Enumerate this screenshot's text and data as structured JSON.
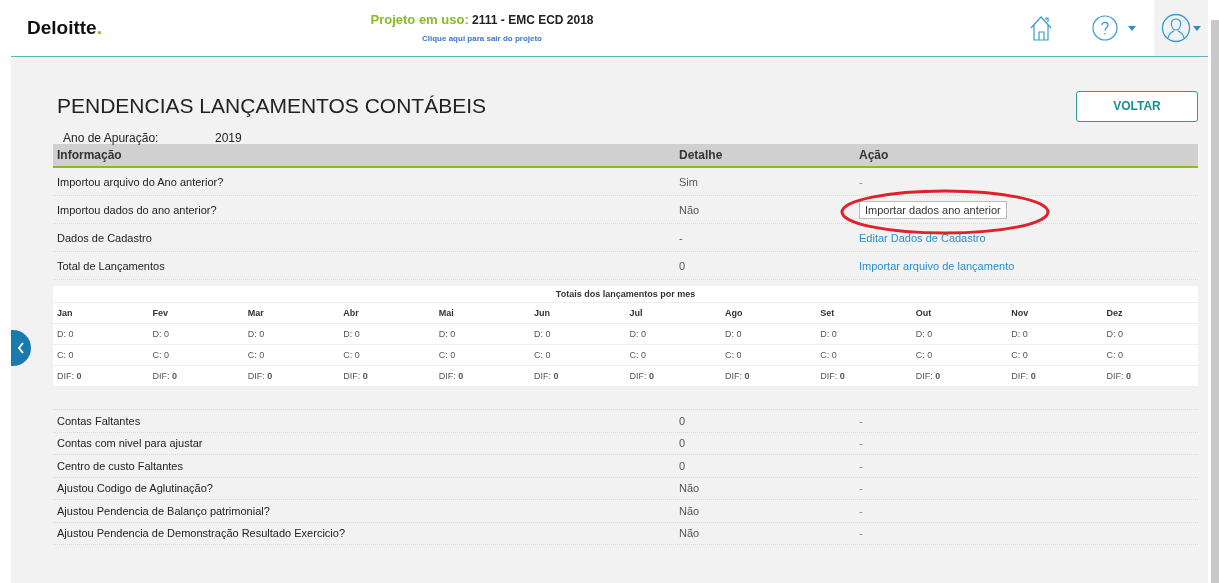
{
  "header": {
    "logo": "Deloitte",
    "logo_dot": ".",
    "project_label": "Projeto em uso:",
    "project_name": "2111 - EMC ECD 2018",
    "exit_link": "Clique aqui para sair do projeto"
  },
  "page": {
    "title": "PENDENCIAS LANÇAMENTOS CONTÁBEIS",
    "back_button": "VOLTAR",
    "year_label": "Ano de Apuração:",
    "year_value": "2019"
  },
  "table": {
    "columns": [
      "Informação",
      "Detalhe",
      "Ação"
    ],
    "rows": [
      {
        "info": "Importou arquivo do Ano anterior?",
        "detail": "Sim",
        "action": {
          "kind": "text",
          "text": "-"
        }
      },
      {
        "info": "Importou dados do ano anterior?",
        "detail": "Não",
        "action": {
          "kind": "button",
          "text": "Importar dados ano anterior",
          "circled": true
        }
      },
      {
        "info": "Dados de Cadastro",
        "detail": "-",
        "action": {
          "kind": "link",
          "text": "Editar Dados de Cadastro"
        }
      },
      {
        "info": "Total de Lançamentos",
        "detail": "0",
        "action": {
          "kind": "link",
          "text": "Importar arquivo de lançamento"
        }
      }
    ]
  },
  "monthly": {
    "title": "Totais dos lançamentos por mes",
    "months": [
      {
        "label": "Jan",
        "debit": "D: 0",
        "credit": "C: 0",
        "difference": "DIF: **0**"
      },
      {
        "label": "Fev",
        "debit": "D: 0",
        "credit": "C: 0",
        "difference": "DIF: **0**"
      },
      {
        "label": "Mar",
        "debit": "D: 0",
        "credit": "C: 0",
        "difference": "DIF: **0**"
      },
      {
        "label": "Abr",
        "debit": "D: 0",
        "credit": "C: 0",
        "difference": "DIF: **0**"
      },
      {
        "label": "Mai",
        "debit": "D: 0",
        "credit": "C: 0",
        "difference": "DIF: **0**"
      },
      {
        "label": "Jun",
        "debit": "D: 0",
        "credit": "C: 0",
        "difference": "DIF: **0**"
      },
      {
        "label": "Jul",
        "debit": "D: 0",
        "credit": "C: 0",
        "difference": "DIF: **0**"
      },
      {
        "label": "Ago",
        "debit": "D: 0",
        "credit": "C: 0",
        "difference": "DIF: **0**"
      },
      {
        "label": "Set",
        "debit": "D: 0",
        "credit": "C: 0",
        "difference": "DIF: **0**"
      },
      {
        "label": "Out",
        "debit": "D: 0",
        "credit": "C: 0",
        "difference": "DIF: **0**"
      },
      {
        "label": "Nov",
        "debit": "D: 0",
        "credit": "C: 0",
        "difference": "DIF: **0**"
      },
      {
        "label": "Dez",
        "debit": "D: 0",
        "credit": "C: 0",
        "difference": "DIF: **0**"
      }
    ]
  },
  "pending": {
    "rows": [
      {
        "info": "Contas Faltantes",
        "detail": "0",
        "action": "-"
      },
      {
        "info": "Contas com nivel para ajustar",
        "detail": "0",
        "action": "-"
      },
      {
        "info": "Centro de custo Faltantes",
        "detail": "0",
        "action": "-"
      },
      {
        "info": "Ajustou Codigo de Aglutinação?",
        "detail": "Não",
        "action": "-"
      },
      {
        "info": "Ajustou Pendencia de Balanço patrimonial?",
        "detail": "Não",
        "action": "-"
      },
      {
        "info": "Ajustou Pendencia de Demonstração Resultado Exercicio?",
        "detail": "Não",
        "action": "-"
      }
    ]
  }
}
